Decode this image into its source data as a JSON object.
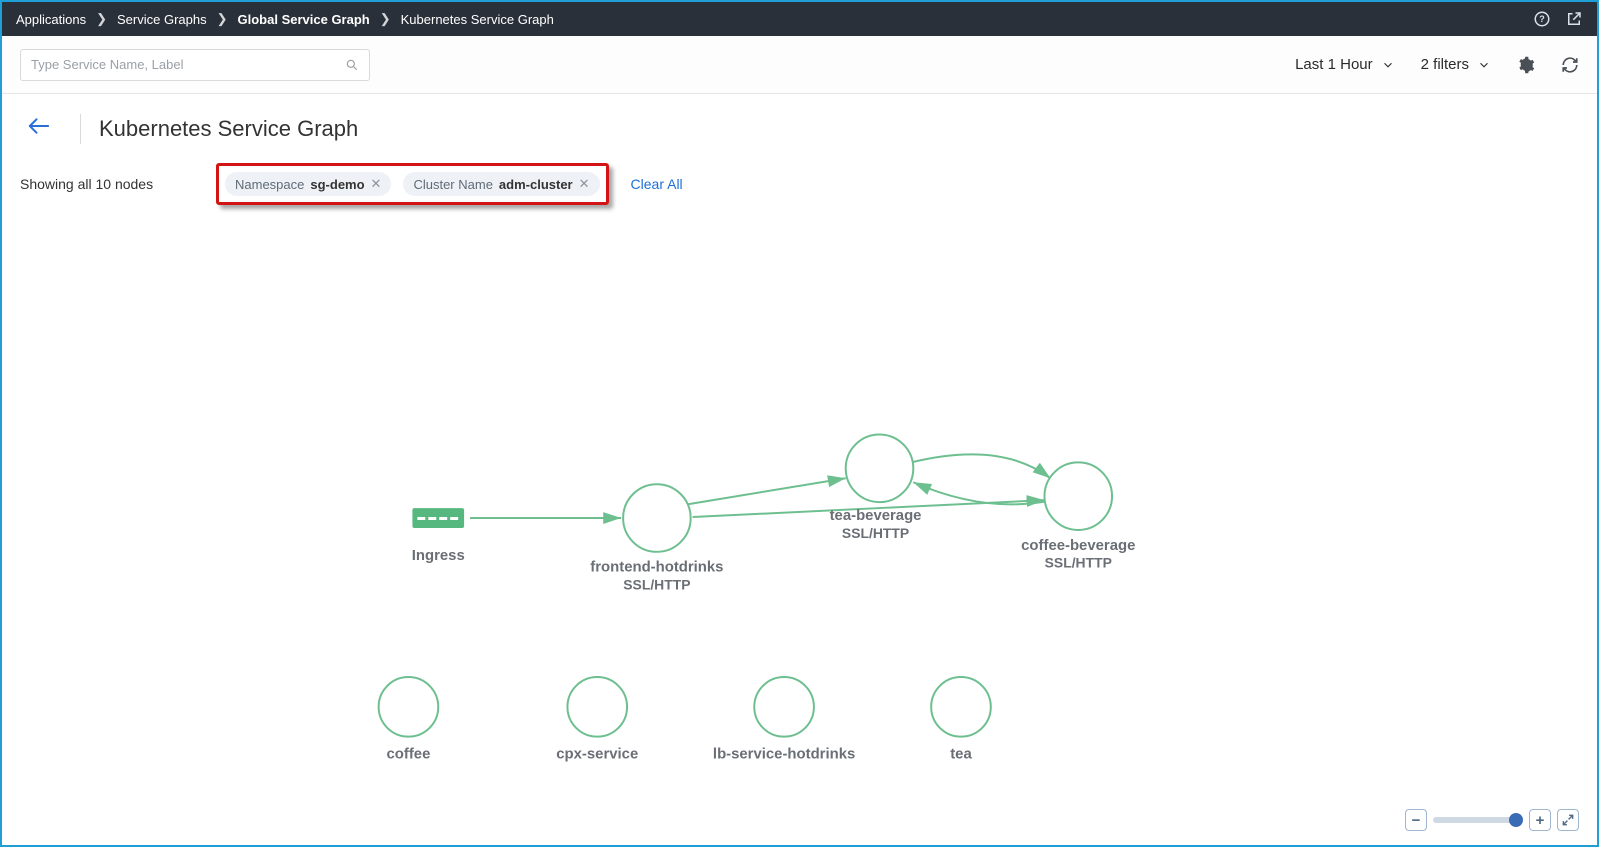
{
  "breadcrumb": {
    "items": [
      {
        "label": "Applications",
        "bold": false
      },
      {
        "label": "Service Graphs",
        "bold": false
      },
      {
        "label": "Global Service Graph",
        "bold": true
      },
      {
        "label": "Kubernetes Service Graph",
        "bold": false
      }
    ]
  },
  "search": {
    "placeholder": "Type Service Name, Label"
  },
  "toolbar": {
    "time_label": "Last 1 Hour",
    "filter_label": "2 filters"
  },
  "page": {
    "title": "Kubernetes Service Graph"
  },
  "filters": {
    "node_count_text": "Showing all 10 nodes",
    "chips": [
      {
        "key": "Namespace",
        "value": "sg-demo"
      },
      {
        "key": "Cluster Name",
        "value": "adm-cluster"
      }
    ],
    "clear_all_label": "Clear All"
  },
  "graph": {
    "edges_color": "#6dbf8f",
    "nodes": {
      "ingress": {
        "label": "Ingress"
      },
      "frontend": {
        "label": "frontend-hotdrinks",
        "sub": "SSL/HTTP"
      },
      "tea_beverage": {
        "label": "tea-beverage",
        "sub": "SSL/HTTP"
      },
      "coffee_beverage": {
        "label": "coffee-beverage",
        "sub": "SSL/HTTP"
      },
      "coffee": {
        "label": "coffee"
      },
      "cpx": {
        "label": "cpx-service"
      },
      "lb": {
        "label": "lb-service-hotdrinks"
      },
      "tea": {
        "label": "tea"
      }
    }
  },
  "zoom": {
    "percent": 85
  }
}
